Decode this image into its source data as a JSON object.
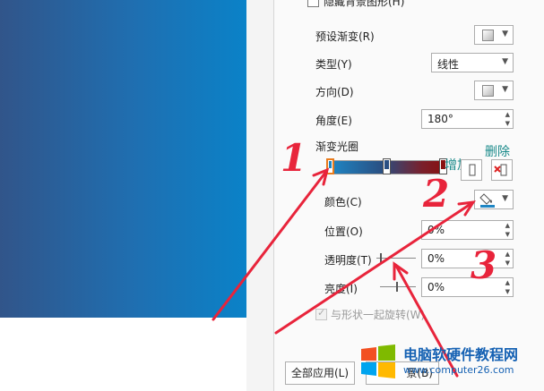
{
  "pane": {
    "hide_background": "隐藏背景图形(H)",
    "preset_gradient": "预设渐变(R)",
    "type_label": "类型(Y)",
    "type_value": "线性",
    "direction": "方向(D)",
    "angle": "角度(E)",
    "angle_value": "180°",
    "gradient_stops": "渐变光圈",
    "color": "颜色(C)",
    "position": "位置(O)",
    "position_value": "0%",
    "transparency": "透明度(T)",
    "transparency_value": "0%",
    "brightness": "亮度(I)",
    "brightness_value": "0%",
    "rotate_with_shape": "与形状一起旋转(W)",
    "apply_all": "全部应用(L)",
    "reset_label_partial": "景(B)"
  },
  "annotations": {
    "add": "增加",
    "delete": "删除",
    "num1": "1",
    "num2": "2",
    "num3": "3"
  },
  "watermark": {
    "title": "电脑软硬件教程网",
    "url": "www.computer26.com"
  },
  "colors": {
    "accent_red": "#e8243b",
    "annotation_teal": "#1a8a8a",
    "brand_blue": "#1561b3"
  }
}
